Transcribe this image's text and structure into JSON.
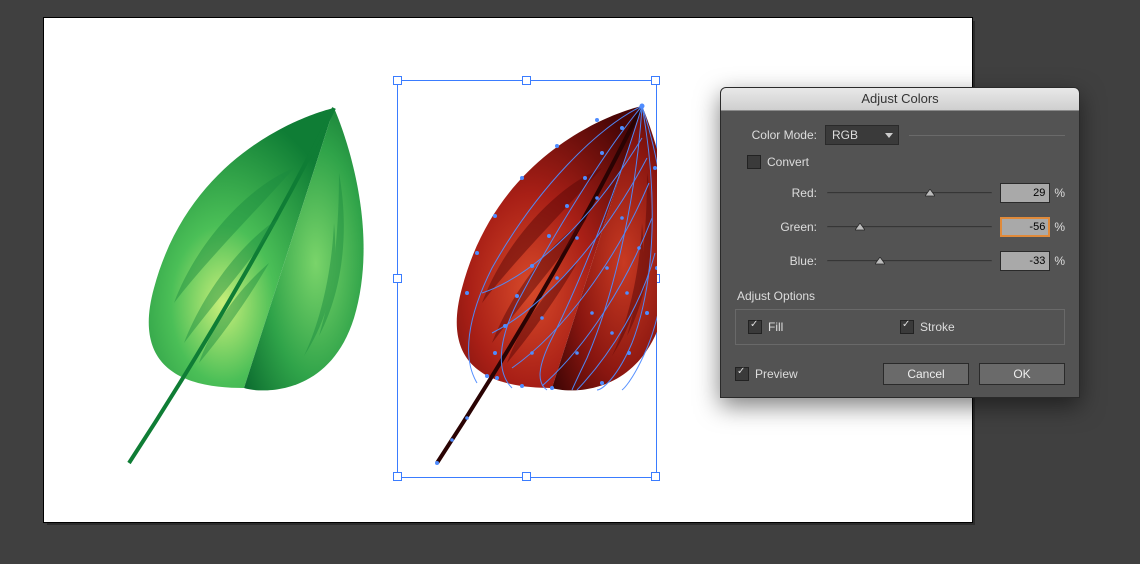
{
  "dialog": {
    "title": "Adjust Colors",
    "colorModeLabel": "Color Mode:",
    "colorModeValue": "RGB",
    "convertLabel": "Convert",
    "convertChecked": false,
    "sliders": [
      {
        "label": "Red:",
        "value": "29",
        "pos": 62,
        "focus": false
      },
      {
        "label": "Green:",
        "value": "-56",
        "pos": 20,
        "focus": true
      },
      {
        "label": "Blue:",
        "value": "-33",
        "pos": 32,
        "focus": false
      }
    ],
    "pct": "%",
    "adjustOptionsTitle": "Adjust Options",
    "fillLabel": "Fill",
    "fillChecked": true,
    "strokeLabel": "Stroke",
    "strokeChecked": true,
    "previewLabel": "Preview",
    "previewChecked": true,
    "cancelLabel": "Cancel",
    "okLabel": "OK"
  }
}
